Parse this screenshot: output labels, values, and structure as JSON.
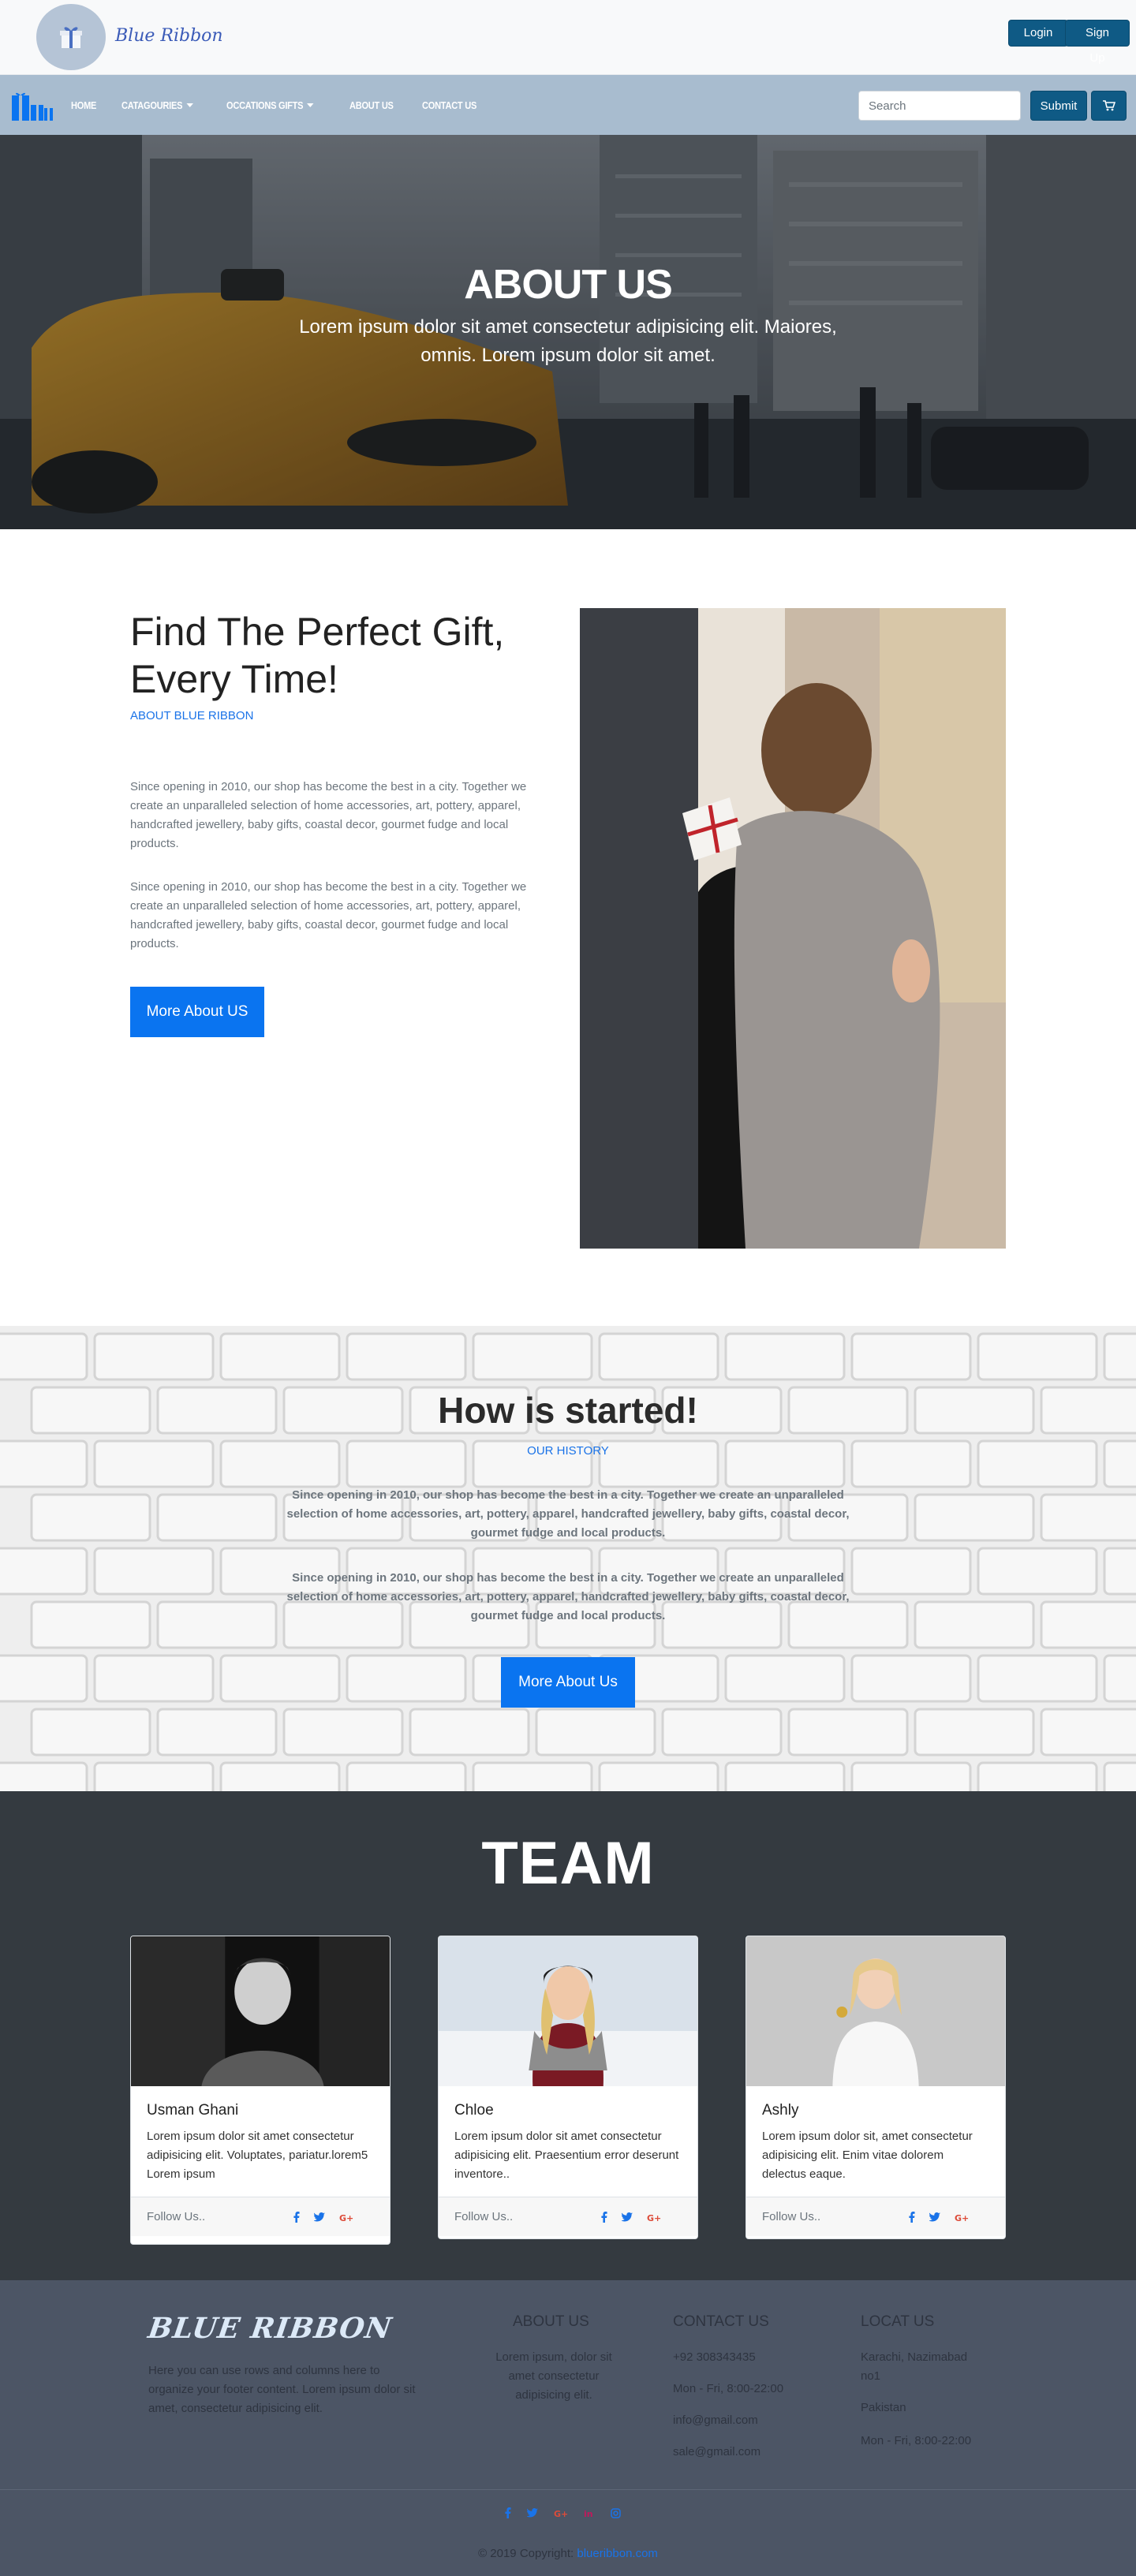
{
  "header": {
    "brand": "Blue Ribbon",
    "login_label": "Login",
    "signup_label": "Sign Up"
  },
  "nav": {
    "items": [
      {
        "label": "Home",
        "dropdown": false
      },
      {
        "label": "Catagouries",
        "dropdown": true
      },
      {
        "label": "Occations Gifts",
        "dropdown": true
      },
      {
        "label": "About US",
        "dropdown": false
      },
      {
        "label": "Contact US",
        "dropdown": false
      }
    ],
    "search_placeholder": "Search",
    "submit_label": "Submit",
    "cart_icon": "shopping-cart-icon"
  },
  "hero": {
    "title": "ABOUT US",
    "subtitle": "Lorem ipsum dolor sit amet consectetur adipisicing elit. Maiores, omnis. Lorem ipsum dolor sit amet."
  },
  "find": {
    "title": "Find The Perfect Gift, Every Time!",
    "eyebrow": "ABOUT BLUE RIBBON",
    "paragraph1": "Since opening in 2010, our shop has become the best in a city. Together we create an unparalleled selection of home accessories, art, pottery, apparel, handcrafted jewellery, baby gifts, coastal decor, gourmet fudge and local products.",
    "paragraph2": "Since opening in 2010, our shop has become the best in a city. Together we create an unparalleled selection of home accessories, art, pottery, apparel, handcrafted jewellery, baby gifts, coastal decor, gourmet fudge and local products.",
    "button_label": "More About US"
  },
  "started": {
    "title": "How is started!",
    "eyebrow": "OUR HISTORY",
    "paragraph1": "Since opening in 2010, our shop has become the best in a city. Together we create an unparalleled selection of home accessories, art, pottery, apparel, handcrafted jewellery, baby gifts, coastal decor, gourmet fudge and local products.",
    "paragraph2": "Since opening in 2010, our shop has become the best in a city. Together we create an unparalleled selection of home accessories, art, pottery, apparel, handcrafted jewellery, baby gifts, coastal decor, gourmet fudge and local products.",
    "button_label": "More About Us"
  },
  "team": {
    "title": "TEAM",
    "members": [
      {
        "name": "Usman Ghani",
        "text": "Lorem ipsum dolor sit amet consectetur adipisicing elit. Voluptates, pariatur.lorem5 Lorem ipsum",
        "follow": "Follow Us.."
      },
      {
        "name": "Chloe",
        "text": "Lorem ipsum dolor sit amet consectetur adipisicing elit. Praesentium error deserunt inventore..",
        "follow": "Follow Us.."
      },
      {
        "name": "Ashly",
        "text": "Lorem ipsum dolor sit, amet consectetur adipisicing elit. Enim vitae dolorem delectus eaque.",
        "follow": "Follow Us.."
      }
    ]
  },
  "footer": {
    "brand": "BLUE RIBBON",
    "description": "Here you can use rows and columns here to organize your footer content. Lorem ipsum dolor sit amet, consectetur adipisicing elit.",
    "about_heading": "ABOUT US",
    "about_text": "Lorem ipsum, dolor sit amet consectetur adipisicing elit.",
    "contact_heading": "CONTACT US",
    "contact_items": [
      "+92 308343435",
      "Mon - Fri, 8:00-22:00",
      "info@gmail.com",
      "sale@gmail.com"
    ],
    "location_heading": "LOCAT US",
    "location_items": [
      "Karachi, Nazimabad no1",
      "Pakistan",
      "Mon - Fri, 8:00-22:00"
    ],
    "copyright_prefix": "© 2019 Copyright:",
    "copyright_link": "blueribbon.com"
  },
  "colors": {
    "primary_blue": "#0a74f0",
    "dark_teal_button": "#0f5a85",
    "nav_background": "#a8bccf",
    "team_background": "#343a40",
    "footer_background": "#4c5565"
  }
}
